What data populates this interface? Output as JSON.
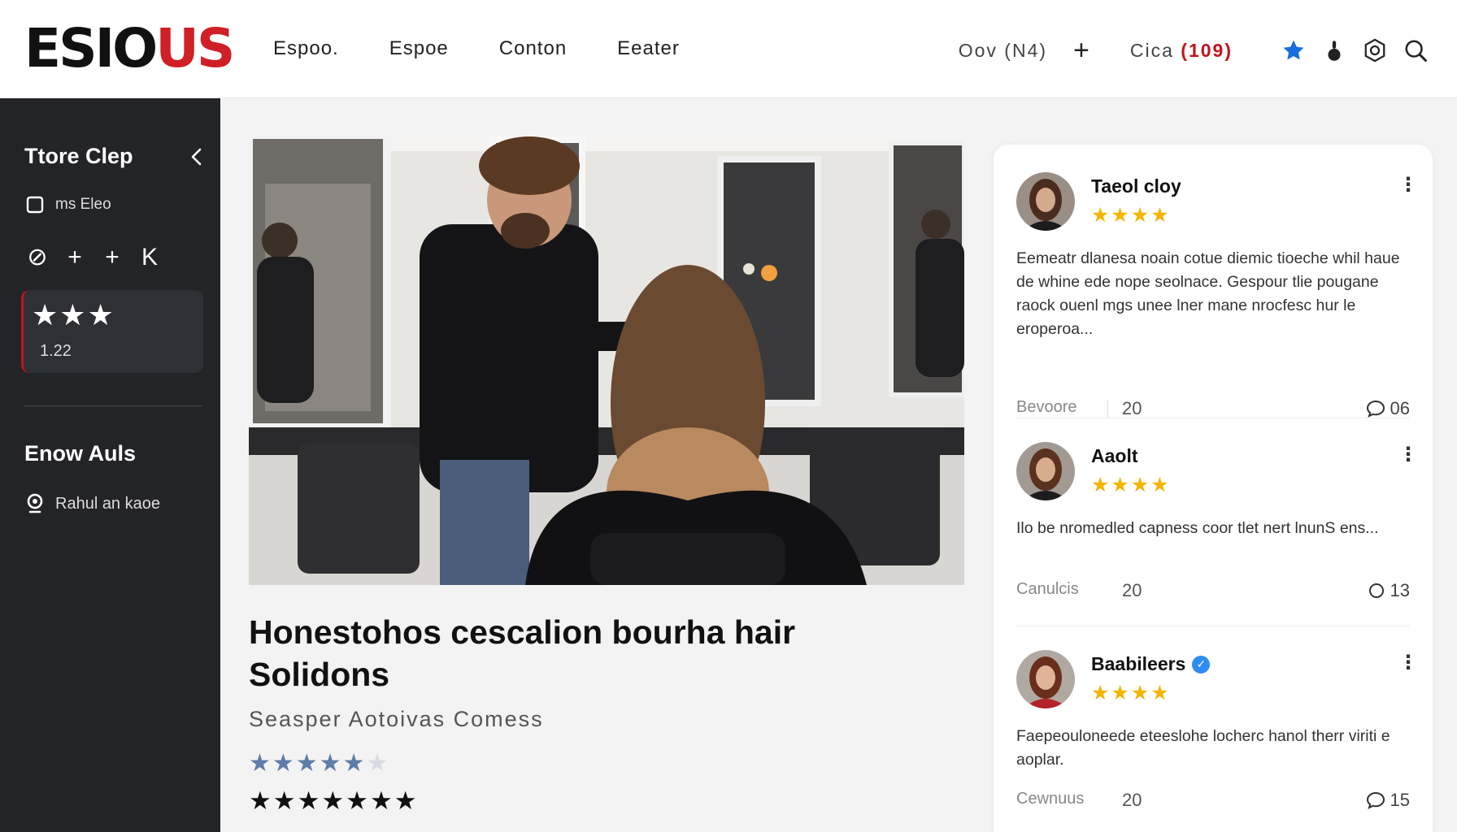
{
  "header": {
    "logo_part1": "ESIO",
    "logo_part2": "US",
    "nav": [
      "Espoo.",
      "Espoe",
      "Conton",
      "Eeater"
    ],
    "ov_label": "Oov (N4)",
    "plus_label": "+",
    "cart_label": "Cica",
    "cart_count": "(109)"
  },
  "sidebar": {
    "title": "Ttore Clep",
    "item1": "ms Eleo",
    "icon_row": [
      "⊘",
      "+",
      "+",
      "K"
    ],
    "card_stars": "★★★",
    "card_num": "1.22",
    "title2": "Enow Auls",
    "item2": "Rahul an kaoe"
  },
  "article": {
    "title": "Honestohos cescalion bourha hair Solidons",
    "subtitle": "Seasper Aotoivas Comess",
    "rating_stars": 4.5,
    "rating_on": "★★★★★",
    "rating_off": "★",
    "rating_row2": "★★★★★★★"
  },
  "reviews": [
    {
      "name": "Taeol cloy",
      "verified": false,
      "stars": "★★★★",
      "text": "Eemeatr dlanesa noain cotue diemic tioeche whil haue de whine ede nope seolnace. Gespour tlie pougane raock ouenl mgs unee lner mane nrocfesc hur le eroperoa...",
      "meta_label": "Bevoore",
      "meta_value": "20",
      "comments": "06"
    },
    {
      "name": "Aaolt",
      "verified": false,
      "stars": "★★★★",
      "text": "Ilo be nromedled capness coor tlet nert lnunS ens...",
      "meta_label": "Canulcis",
      "meta_value": "20",
      "comments": "13"
    },
    {
      "name": "Baabileers",
      "verified": true,
      "stars": "★★★★",
      "text": "Faepeouloneede eteeslohe locherc hanol therr viriti e aoplar.",
      "meta_label": "Cewnuus",
      "meta_value": "20",
      "comments": "15"
    }
  ],
  "colors": {
    "brand_red": "#d01f26",
    "sidebar_bg": "#232428",
    "star_gold": "#f4b400",
    "verified_blue": "#2d8cf0"
  }
}
